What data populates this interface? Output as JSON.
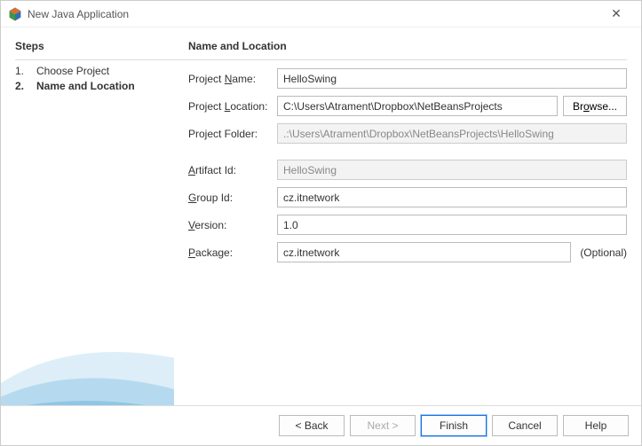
{
  "window": {
    "title": "New Java Application"
  },
  "steps": {
    "heading": "Steps",
    "items": [
      {
        "num": "1.",
        "label": "Choose Project"
      },
      {
        "num": "2.",
        "label": "Name and Location"
      }
    ],
    "currentIndex": 1
  },
  "main": {
    "heading": "Name and Location",
    "fields": {
      "projectName": {
        "label": "Project Name:",
        "value": "HelloSwing"
      },
      "projectLocation": {
        "label": "Project Location:",
        "value": "C:\\Users\\Atrament\\Dropbox\\NetBeansProjects",
        "browse": "Browse..."
      },
      "projectFolder": {
        "label": "Project Folder:",
        "value": ".:\\Users\\Atrament\\Dropbox\\NetBeansProjects\\HelloSwing"
      },
      "artifactId": {
        "label": "Artifact Id:",
        "value": "HelloSwing"
      },
      "groupId": {
        "label": "Group Id:",
        "value": "cz.itnetwork"
      },
      "version": {
        "label": "Version:",
        "value": "1.0"
      },
      "package": {
        "label": "Package:",
        "value": "cz.itnetwork",
        "optional": "(Optional)"
      }
    }
  },
  "footer": {
    "back": "< Back",
    "next": "Next >",
    "finish": "Finish",
    "cancel": "Cancel",
    "help": "Help"
  }
}
